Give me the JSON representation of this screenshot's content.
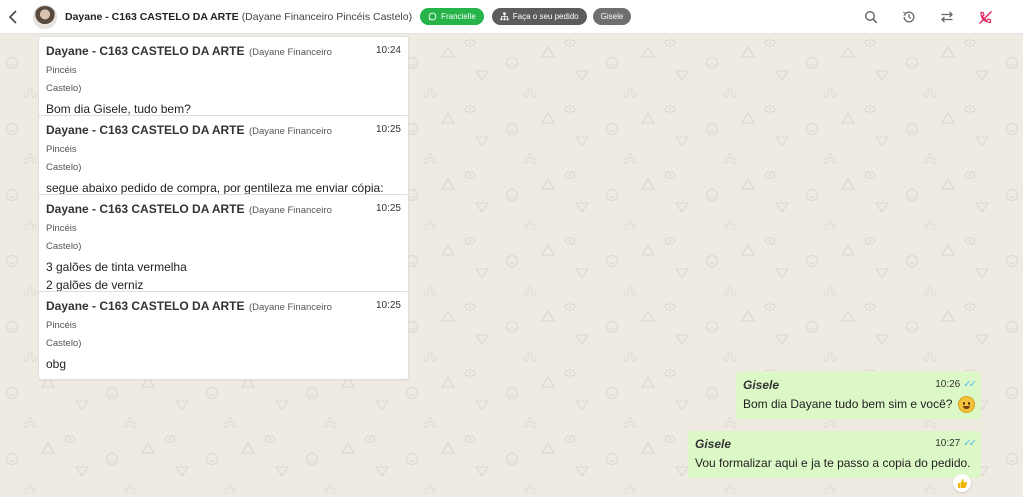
{
  "header": {
    "contact_name": "Dayane - C163 CASTELO DA ARTE",
    "contact_sub": "(Dayane Financeiro Pincéis Castelo)",
    "tags": [
      {
        "label": "Francielle",
        "color": "#25b34a"
      },
      {
        "label": "Faça o seu pedido",
        "color": "#5c5c5c"
      },
      {
        "label": "Gisele",
        "color": "#6f6f6f"
      }
    ]
  },
  "messages_in": [
    {
      "sender": "Dayane - C163 CASTELO DA ARTE",
      "sender_sub_1": "(Dayane Financeiro Pincéis",
      "sender_sub_2": "Castelo)",
      "time": "10:24",
      "lines": [
        "Bom dia Gisele, tudo bem?"
      ]
    },
    {
      "sender": "Dayane - C163 CASTELO DA ARTE",
      "sender_sub_1": "(Dayane Financeiro Pincéis",
      "sender_sub_2": "Castelo)",
      "time": "10:25",
      "lines": [
        "segue abaixo pedido de compra, por gentileza me enviar cópia:"
      ]
    },
    {
      "sender": "Dayane - C163 CASTELO DA ARTE",
      "sender_sub_1": "(Dayane Financeiro Pincéis",
      "sender_sub_2": "Castelo)",
      "time": "10:25",
      "lines": [
        "3 galões de tinta vermelha",
        "2 galões de verniz"
      ]
    },
    {
      "sender": "Dayane - C163 CASTELO DA ARTE",
      "sender_sub_1": "(Dayane Financeiro Pincéis",
      "sender_sub_2": "Castelo)",
      "time": "10:25",
      "lines": [
        "obg"
      ]
    }
  ],
  "messages_out": [
    {
      "sender": "Gisele",
      "time": "10:26",
      "text": "Bom dia Dayane tudo bem sim e você?",
      "emoji": "grinning-face"
    },
    {
      "sender": "Gisele",
      "time": "10:27",
      "text": "Vou formalizar aqui e ja te passo a copia do pedido."
    }
  ],
  "reaction": {
    "emoji": "thumbs-up"
  },
  "colors": {
    "incoming_bg": "#ffffff",
    "outgoing_bg": "#dcf8c6",
    "read_ticks": "#53bdeb",
    "chat_bg": "#efeae2"
  }
}
